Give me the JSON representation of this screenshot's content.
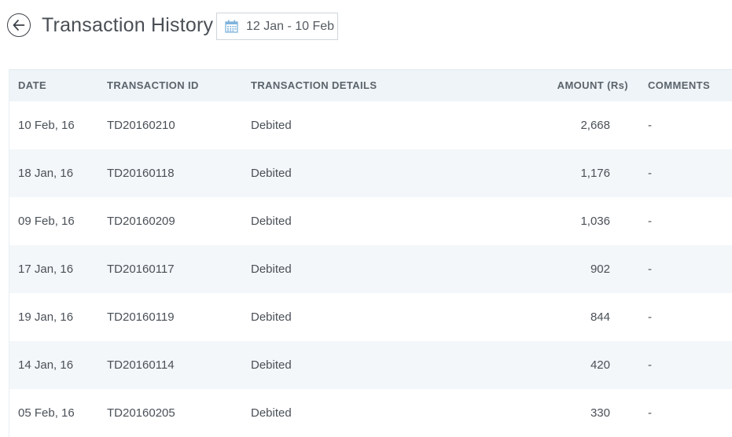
{
  "header": {
    "title": "Transaction History",
    "date_range": "12 Jan - 10 Feb",
    "back_icon": "arrow-left-icon",
    "calendar_icon": "calendar-icon"
  },
  "colors": {
    "header_bg": "#eef4f7",
    "alt_row_bg": "#f3f7f9",
    "calendar_icon": "#7fb3dc"
  },
  "table": {
    "columns": [
      "DATE",
      "TRANSACTION ID",
      "TRANSACTION DETAILS",
      "AMOUNT (Rs)",
      "COMMENTS"
    ],
    "rows": [
      {
        "date": "10 Feb, 16",
        "id": "TD20160210",
        "details": "Debited",
        "amount": "2,668",
        "comments": "-"
      },
      {
        "date": "18 Jan, 16",
        "id": "TD20160118",
        "details": "Debited",
        "amount": "1,176",
        "comments": "-"
      },
      {
        "date": "09 Feb, 16",
        "id": "TD20160209",
        "details": "Debited",
        "amount": "1,036",
        "comments": "-"
      },
      {
        "date": "17 Jan, 16",
        "id": "TD20160117",
        "details": "Debited",
        "amount": "902",
        "comments": "-"
      },
      {
        "date": "19 Jan, 16",
        "id": "TD20160119",
        "details": "Debited",
        "amount": "844",
        "comments": "-"
      },
      {
        "date": "14 Jan, 16",
        "id": "TD20160114",
        "details": "Debited",
        "amount": "420",
        "comments": "-"
      },
      {
        "date": "05 Feb, 16",
        "id": "TD20160205",
        "details": "Debited",
        "amount": "330",
        "comments": "-"
      }
    ]
  }
}
